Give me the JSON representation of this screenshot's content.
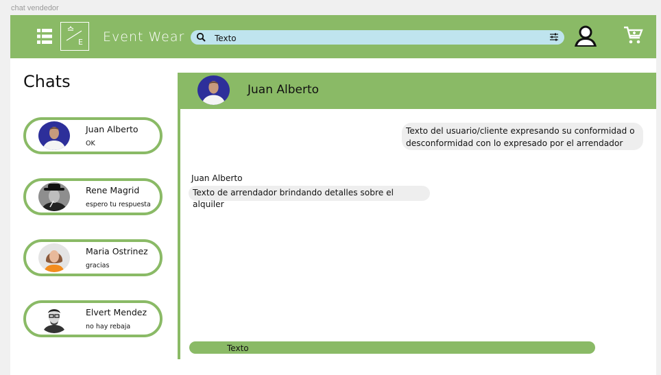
{
  "frame_label": "chat vendedor",
  "header": {
    "logo_name": "Event Wear",
    "logo_mark_letter": "E",
    "search_placeholder": "Texto",
    "colors": {
      "accent": "#8aba66",
      "search_bg": "#bfe4ee"
    },
    "icons": [
      "menu-grid-icon",
      "hanger-logo-icon",
      "search-icon",
      "filter-icon",
      "user-icon",
      "cart-icon"
    ]
  },
  "sidebar": {
    "title": "Chats",
    "items": [
      {
        "name": "Juan Alberto",
        "preview": "OK",
        "avatar_bg": "#2d2f9a"
      },
      {
        "name": "Rene Magrid",
        "preview": "espero tu respuesta",
        "avatar_bg": "#555555"
      },
      {
        "name": "Maria Ostrinez",
        "preview": "gracias",
        "avatar_bg": "#dddddd"
      },
      {
        "name": "Elvert Mendez",
        "preview": "no hay rebaja",
        "avatar_bg": "#eeeeee"
      }
    ]
  },
  "conversation": {
    "contact_name": "Juan Alberto",
    "messages": [
      {
        "direction": "out",
        "text": "Texto del usuario/cliente expresando su conformidad o desconformidad con lo expresado por el arrendador"
      },
      {
        "direction": "in",
        "sender": "Juan Alberto",
        "text": "Texto de arrendador brindando detalles sobre el alquiler"
      }
    ],
    "compose_placeholder": "Texto"
  }
}
